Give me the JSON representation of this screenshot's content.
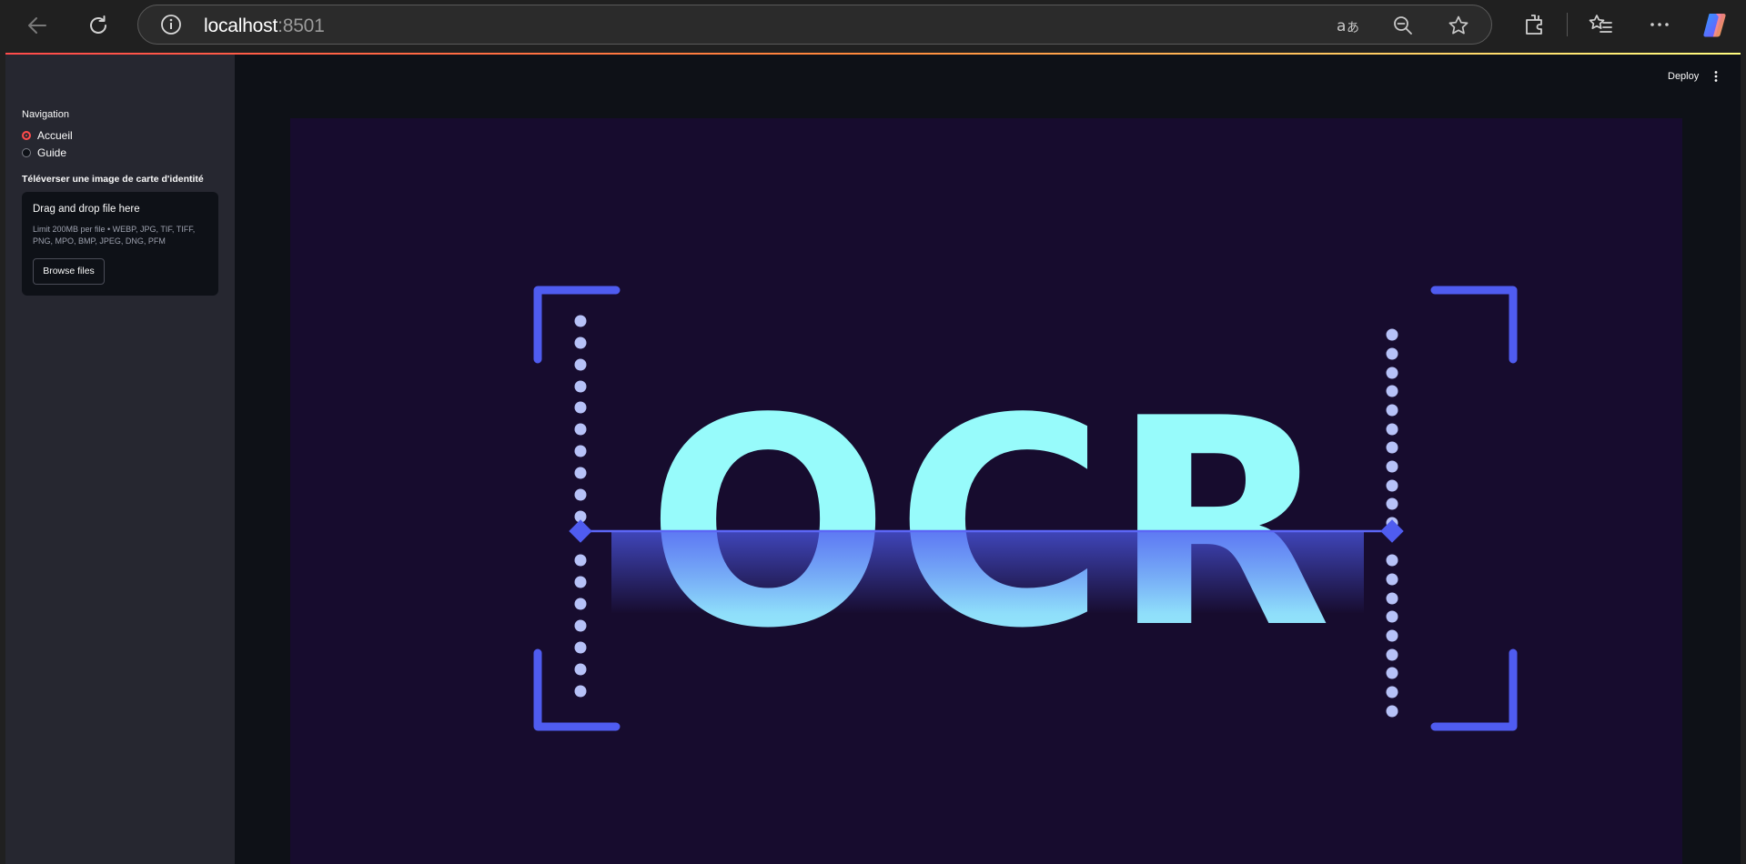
{
  "browser": {
    "url_host": "localhost",
    "url_port": ":8501",
    "icons": [
      "back-arrow-icon",
      "refresh-icon",
      "info-icon",
      "read-aloud-icon",
      "zoom-out-icon",
      "favorite-star-icon",
      "extensions-icon",
      "favorites-icon",
      "more-icon",
      "copilot-icon"
    ]
  },
  "sidebar": {
    "nav_title": "Navigation",
    "nav_options": [
      {
        "label": "Accueil",
        "selected": true
      },
      {
        "label": "Guide",
        "selected": false
      }
    ],
    "upload_label": "Téléverser une image de carte d'identité",
    "dropzone_title": "Drag and drop file here",
    "dropzone_limit": "Limit 200MB per file • WEBP, JPG, TIF, TIFF, PNG, MPO, BMP, JPEG, DNG, PFM",
    "browse_label": "Browse files"
  },
  "header": {
    "deploy_label": "Deploy"
  },
  "banner": {
    "text": "OCR"
  },
  "colors": {
    "accent": "#ff4b4b",
    "banner_bg": "#170c2e",
    "bracket": "#4f5cf0",
    "ocr_text": "#97fbfb"
  }
}
